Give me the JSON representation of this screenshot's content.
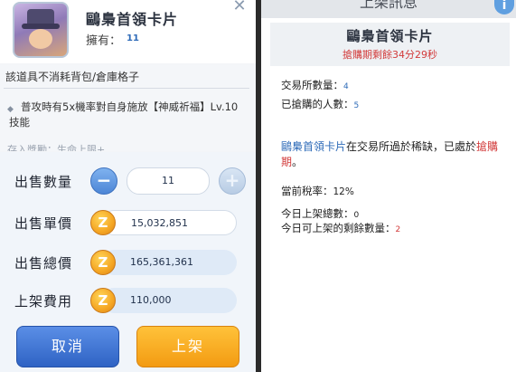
{
  "item": {
    "name": "鷗梟首領卡片",
    "own_label": "擁有：",
    "own_count": "11",
    "description": "該道具不消耗背包/倉庫格子",
    "effect": "普攻時有5x機率對自身施放【神威祈福】Lv.10技能",
    "cut_text": "存入獎勵：生命上限+..."
  },
  "sale": {
    "quantity_label": "出售數量",
    "quantity_value": "11",
    "unit_price_label": "出售單價",
    "unit_price_value": "15,032,851",
    "total_price_label": "出售總價",
    "total_price_value": "165,361,361",
    "listing_fee_label": "上架費用",
    "listing_fee_value": "110,000",
    "cancel_button": "取消",
    "list_button": "上架"
  },
  "info": {
    "header": "上架訊息",
    "item_name": "鷗梟首領卡片",
    "countdown": "搶購期剩餘34分29秒",
    "exchange_count_label": "交易所數量：",
    "exchange_count": "4",
    "buyers_label": "已搶購的人數：",
    "buyers_count": "5",
    "rare_item_name": "鷗梟首領卡片",
    "rare_mid": "在交易所過於稀缺，已處於",
    "rare_status": "搶購期",
    "rare_end": "。",
    "tax_label": "當前稅率：",
    "tax_value": "12%",
    "today_total_label": "今日上架總數：",
    "today_total": "0",
    "today_remaining_label": "今日可上架的剩餘數量：",
    "today_remaining": "2"
  },
  "icons": {
    "close": "close-icon",
    "info": "info-icon",
    "coin": "zeny-coin-icon",
    "minus": "minus-icon",
    "plus": "plus-icon"
  },
  "colors": {
    "accent_blue": "#2e6bb8",
    "warning_red": "#d23a3a",
    "cancel_blue": "#2f63c4",
    "confirm_orange": "#f39b12"
  }
}
